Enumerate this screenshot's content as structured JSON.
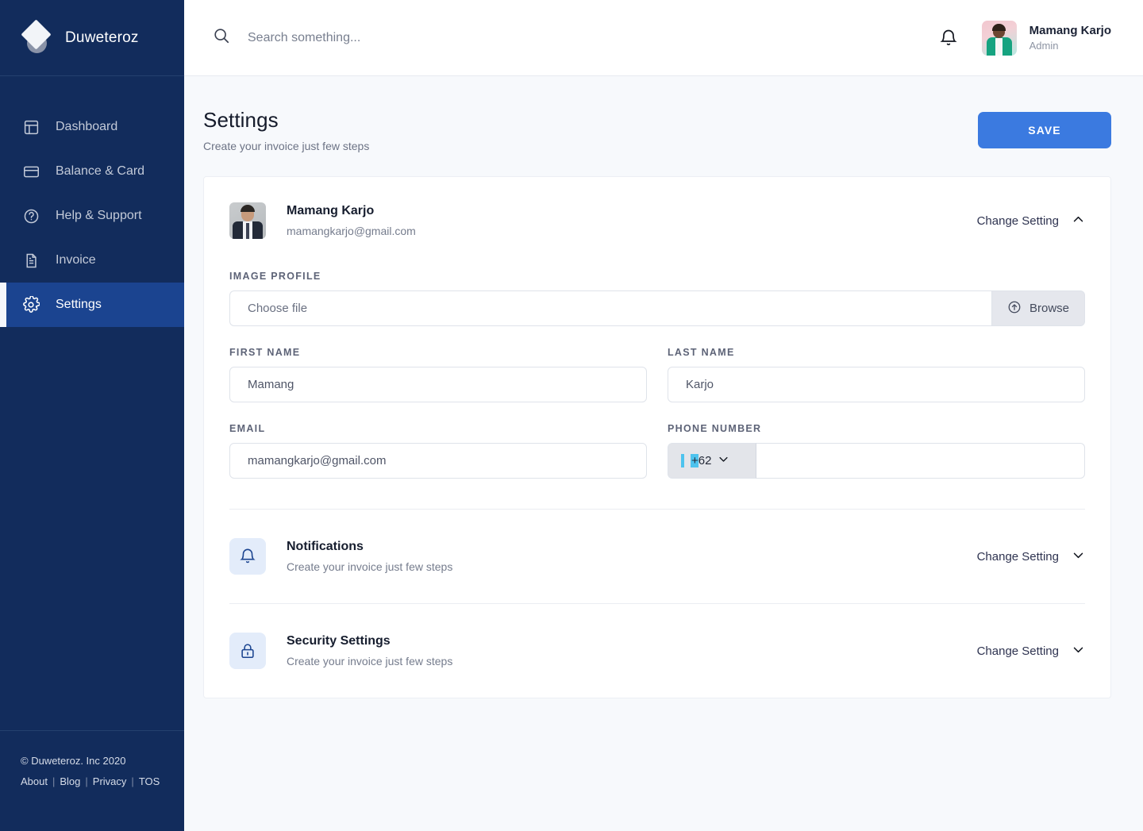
{
  "brand": {
    "name": "Duweteroz",
    "logo_icon": "diamond-logo-icon"
  },
  "sidebar": {
    "items": [
      {
        "label": "Dashboard",
        "icon": "layout-dashboard-icon",
        "active": false
      },
      {
        "label": "Balance & Card",
        "icon": "credit-card-icon",
        "active": false
      },
      {
        "label": "Help & Support",
        "icon": "question-circle-icon",
        "active": false
      },
      {
        "label": "Invoice",
        "icon": "document-icon",
        "active": false
      },
      {
        "label": "Settings",
        "icon": "gear-icon",
        "active": true
      }
    ],
    "footer": {
      "copyright": "© Duweteroz. Inc 2020",
      "links": [
        "About",
        "Blog",
        "Privacy",
        "TOS"
      ],
      "separator": "|"
    }
  },
  "topbar": {
    "search_placeholder": "Search something...",
    "search_value": "",
    "search_icon": "search-icon",
    "bell_icon": "bell-icon",
    "user": {
      "name": "Mamang Karjo",
      "role": "Admin",
      "avatar": "user-avatar-photo"
    }
  },
  "page": {
    "title": "Settings",
    "subtitle": "Create your invoice just few steps",
    "save_label": "SAVE",
    "save_color": "#3b7ae0"
  },
  "profile": {
    "name": "Mamang Karjo",
    "email": "mamangkarjo@gmail.com",
    "change_setting_label": "Change Setting",
    "chevron": "chevron-up-icon"
  },
  "form": {
    "image_profile": {
      "label": "IMAGE PROFILE",
      "placeholder": "Choose file",
      "value": "",
      "browse_label": "Browse",
      "browse_icon": "upload-circle-icon"
    },
    "first_name": {
      "label": "FIRST NAME",
      "value": "Mamang"
    },
    "last_name": {
      "label": "LAST NAME",
      "value": "Karjo"
    },
    "email": {
      "label": "EMAIL",
      "value": "mamangkarjo@gmail.com"
    },
    "phone": {
      "label": "PHONE NUMBER",
      "country_code": "+62",
      "value": "",
      "chevron": "chevron-down-icon",
      "selection_highlight_color": "#4ec3ee"
    }
  },
  "sections": [
    {
      "title": "Notifications",
      "subtitle": "Create your invoice just few steps",
      "icon": "bell-icon",
      "action_label": "Change Setting",
      "chevron": "chevron-down-icon"
    },
    {
      "title": "Security Settings",
      "subtitle": "Create your invoice just few steps",
      "icon": "lock-icon",
      "action_label": "Change Setting",
      "chevron": "chevron-down-icon"
    }
  ]
}
